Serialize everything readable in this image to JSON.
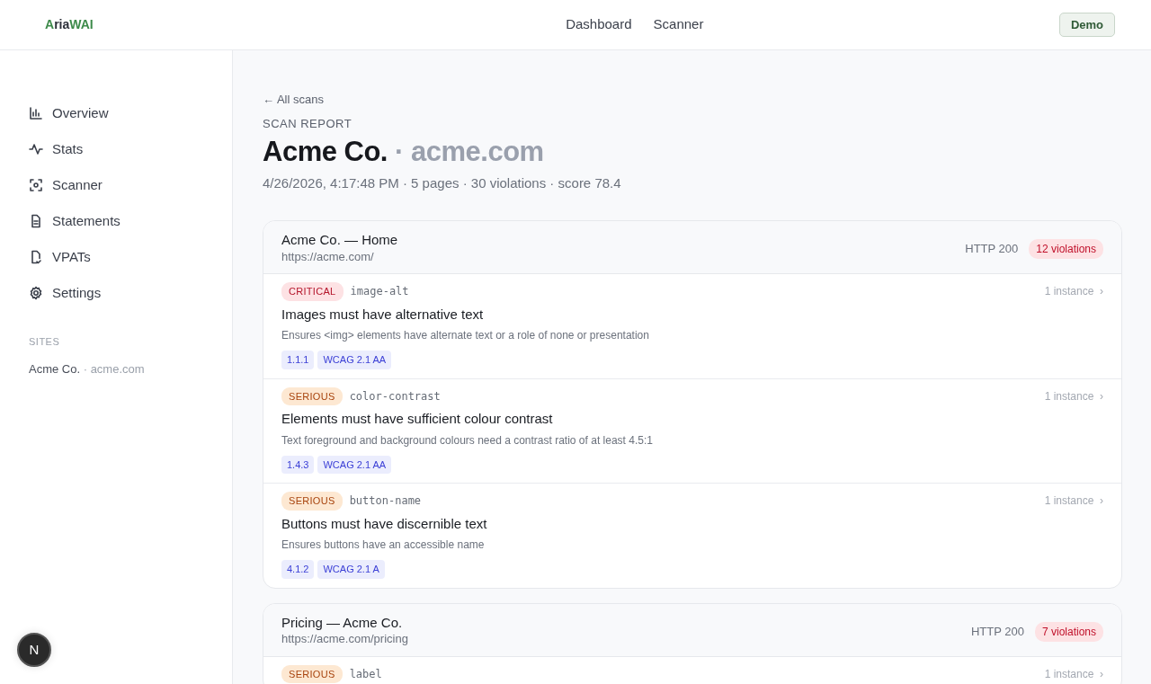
{
  "logo": {
    "mark": "A",
    "text": "ria",
    "accent": "WAI"
  },
  "top_nav": [
    "Dashboard",
    "Scanner"
  ],
  "demo_button": "Demo",
  "sidebar": {
    "items": [
      "Overview",
      "Stats",
      "Scanner",
      "Statements",
      "VPATs",
      "Settings"
    ],
    "sites_heading": "SITES",
    "sites": [
      {
        "name": "Acme Co.",
        "domain": "· acme.com"
      }
    ]
  },
  "back_link": "← All scans",
  "eyebrow": "SCAN REPORT",
  "title": {
    "name": "Acme Co.",
    "domain": "· acme.com"
  },
  "meta": "4/26/2026, 4:17:48 PM · 5 pages · 30 violations · score 78.4",
  "pages": [
    {
      "title": "Acme Co. — Home",
      "url": "https://acme.com/",
      "status": "HTTP 200",
      "count": "12 violations",
      "violations": [
        {
          "severity": "CRITICAL",
          "kind": "critical",
          "rule": "image-alt",
          "instances": "1 instance",
          "chevron": "›",
          "title": "Images must have alternative text",
          "description": "Ensures <img> elements have alternate text or a role of none or presentation",
          "tags": [
            "1.1.1",
            "WCAG 2.1 AA"
          ]
        },
        {
          "severity": "SERIOUS",
          "kind": "serious",
          "rule": "color-contrast",
          "instances": "1 instance",
          "chevron": "›",
          "title": "Elements must have sufficient colour contrast",
          "description": "Text foreground and background colours need a contrast ratio of at least 4.5:1",
          "tags": [
            "1.4.3",
            "WCAG 2.1 AA"
          ]
        },
        {
          "severity": "SERIOUS",
          "kind": "serious",
          "rule": "button-name",
          "instances": "1 instance",
          "chevron": "›",
          "title": "Buttons must have discernible text",
          "description": "Ensures buttons have an accessible name",
          "tags": [
            "4.1.2",
            "WCAG 2.1 A"
          ]
        }
      ]
    },
    {
      "title": "Pricing — Acme Co.",
      "url": "https://acme.com/pricing",
      "status": "HTTP 200",
      "count": "7 violations",
      "violations": [
        {
          "severity": "SERIOUS",
          "kind": "serious",
          "rule": "label",
          "instances": "1 instance",
          "chevron": "›"
        }
      ]
    }
  ],
  "dev_badge": "N"
}
